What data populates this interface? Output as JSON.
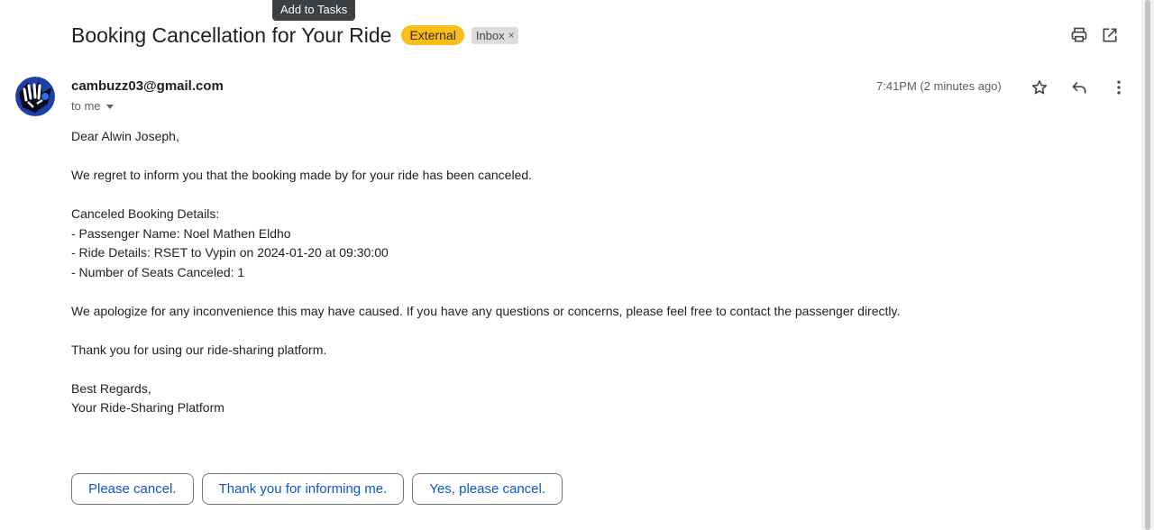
{
  "tooltip": {
    "text": "Add to Tasks"
  },
  "email": {
    "subject": "Booking Cancellation for Your Ride",
    "labels": {
      "external": "External",
      "inbox": "Inbox",
      "inbox_remove": "×"
    },
    "header_icons": [
      "print-icon",
      "open-in-new-window-icon"
    ],
    "sender": {
      "email": "cambuzz03@gmail.com",
      "recipient": "to me",
      "timestamp": "7:41PM (2 minutes ago)"
    },
    "row_icons": [
      "star-icon",
      "reply-icon",
      "more-vert-icon"
    ],
    "body": {
      "greeting": "Dear Alwin Joseph,",
      "intro": "We regret to inform you that the booking made by  for your ride has been canceled.",
      "details_heading": "Canceled Booking Details:",
      "passenger": "- Passenger Name: Noel Mathen Eldho",
      "ride": "- Ride Details: RSET to Vypin on 2024-01-20 at 09:30:00",
      "seats": "- Number of Seats Canceled: 1",
      "apology": "We apologize for any inconvenience this may have caused. If you have any questions or concerns, please feel free to contact the passenger directly.",
      "thanks": "Thank you for using our ride-sharing platform.",
      "closing": "Best Regards,",
      "signature": "Your Ride-Sharing Platform"
    },
    "smart_replies": [
      "Please cancel.",
      "Thank you for informing me.",
      "Yes, please cancel."
    ]
  },
  "colors": {
    "external_label": "#f8bf1a",
    "inbox_label": "#dddddd",
    "reply_text": "#0b57d0",
    "tooltip_bg": "#3c4043"
  }
}
